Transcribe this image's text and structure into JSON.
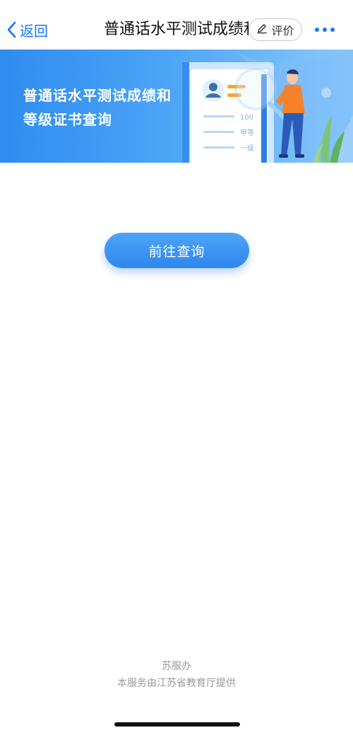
{
  "navbar": {
    "back_label": "返回",
    "title": "普通话水平测试成绩和等级证书查询",
    "rate_label": "评价",
    "back_icon": "chevron-left-icon",
    "rate_icon": "pencil-icon",
    "more_icon": "more-dots-icon",
    "accent_color": "#1677ff"
  },
  "banner": {
    "title": "普通话水平测试成绩和等级证书查询",
    "card_score": "100",
    "card_grade": "甲等",
    "card_level": "一级",
    "gradient_start": "#2f8cf0",
    "gradient_end": "#8cc8fb"
  },
  "main": {
    "query_button_label": "前往查询",
    "button_color": "#2f86ec"
  },
  "footer": {
    "brand": "苏服办",
    "provider": "本服务由江苏省教育厅提供"
  }
}
